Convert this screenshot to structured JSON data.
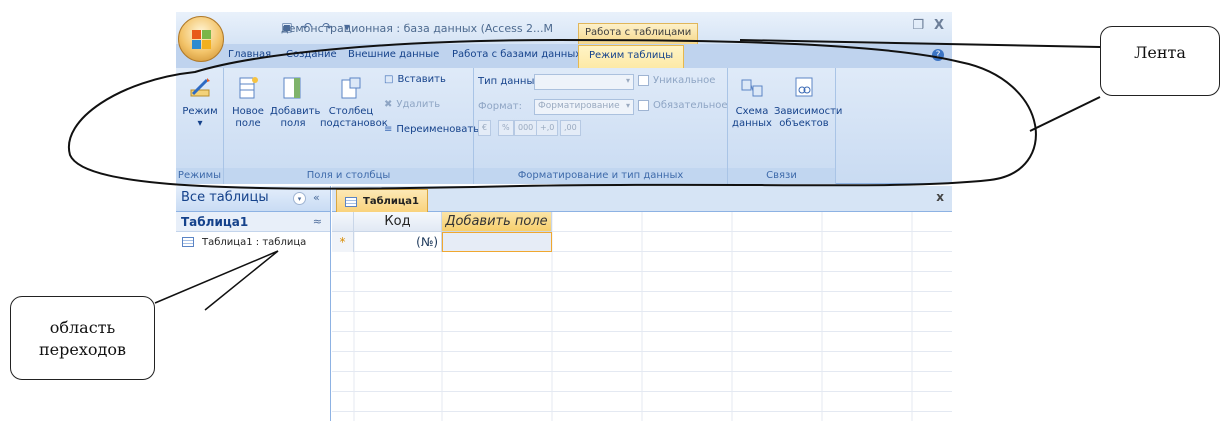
{
  "window": {
    "title": "демонстрационная : база данных (Access 2...",
    "title_suffix": "М",
    "context_tab": "Работа с таблицами",
    "maximize_glyph": "▫",
    "close_glyph": "X"
  },
  "tabs": [
    "Главная",
    "Создание",
    "Внешние данные",
    "Работа с базами данных",
    "Режим таблицы"
  ],
  "help_glyph": "?",
  "ribbon": {
    "views": {
      "label": "Режимы",
      "button": "Режим",
      "dropdown": "▾"
    },
    "fields": {
      "label": "Поля и столбцы",
      "new_field": [
        "Новое",
        "поле"
      ],
      "add_field": [
        "Добавить",
        "поля"
      ],
      "lookup": [
        "Столбец",
        "подстановок"
      ],
      "insert": "Вставить",
      "delete": "Удалить",
      "rename": "Переименовать"
    },
    "format": {
      "label": "Форматирование и тип данных",
      "data_type_label": "Тип данных:",
      "format_label": "Формат:",
      "format_value": "Форматирование",
      "unique": "Уникальное",
      "required": "Обязательное",
      "buttons": [
        "%",
        "000",
        "+,0",
        ",00"
      ]
    },
    "relationships": {
      "label": "Связи",
      "schema": [
        "Схема",
        "данных"
      ],
      "dependencies": [
        "Зависимости",
        "объектов"
      ]
    }
  },
  "nav": {
    "title": "Все таблицы",
    "collapse_glyph": "«",
    "group": "Таблица1",
    "group_glyph": "≈",
    "items": [
      "Таблица1 : таблица"
    ]
  },
  "document": {
    "tab": "Таблица1",
    "close_glyph": "x",
    "columns": [
      "Код",
      "Добавить поле"
    ],
    "rows": [
      {
        "marker": "*",
        "code": "(№)",
        "add": ""
      }
    ]
  },
  "annotations": {
    "ribbon_callout": "Лента",
    "nav_callout": [
      "область",
      "переходов"
    ]
  }
}
